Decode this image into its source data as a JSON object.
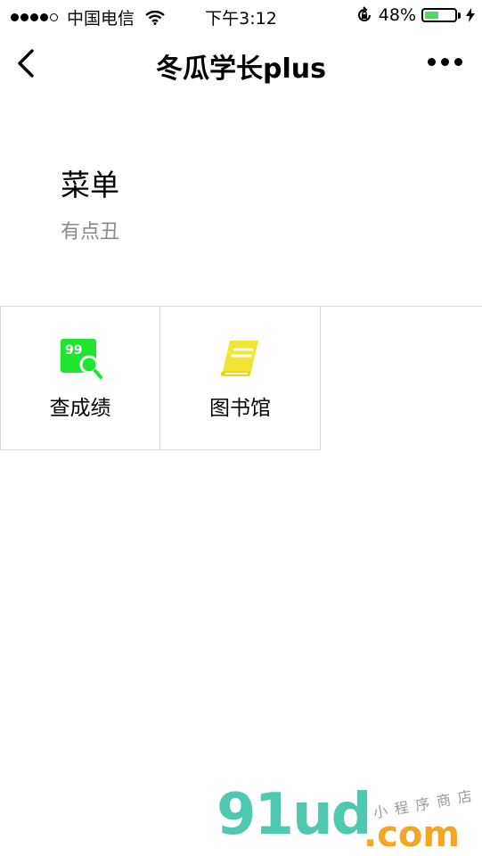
{
  "status_bar": {
    "carrier": "中国电信",
    "time": "下午3:12",
    "battery_text": "48%",
    "battery_level": 0.48
  },
  "nav": {
    "title": "冬瓜学长plus"
  },
  "header": {
    "title": "菜单",
    "desc": "有点丑"
  },
  "grid": {
    "items": [
      {
        "label": "查成绩",
        "icon_text": "99",
        "icon": "score-search-icon",
        "color": "#1ee52d"
      },
      {
        "label": "图书馆",
        "icon": "book-icon",
        "color": "#f2e535"
      }
    ]
  },
  "watermark": {
    "main": "91ud",
    "dotcom": ".com",
    "sub": "小程序商店"
  }
}
